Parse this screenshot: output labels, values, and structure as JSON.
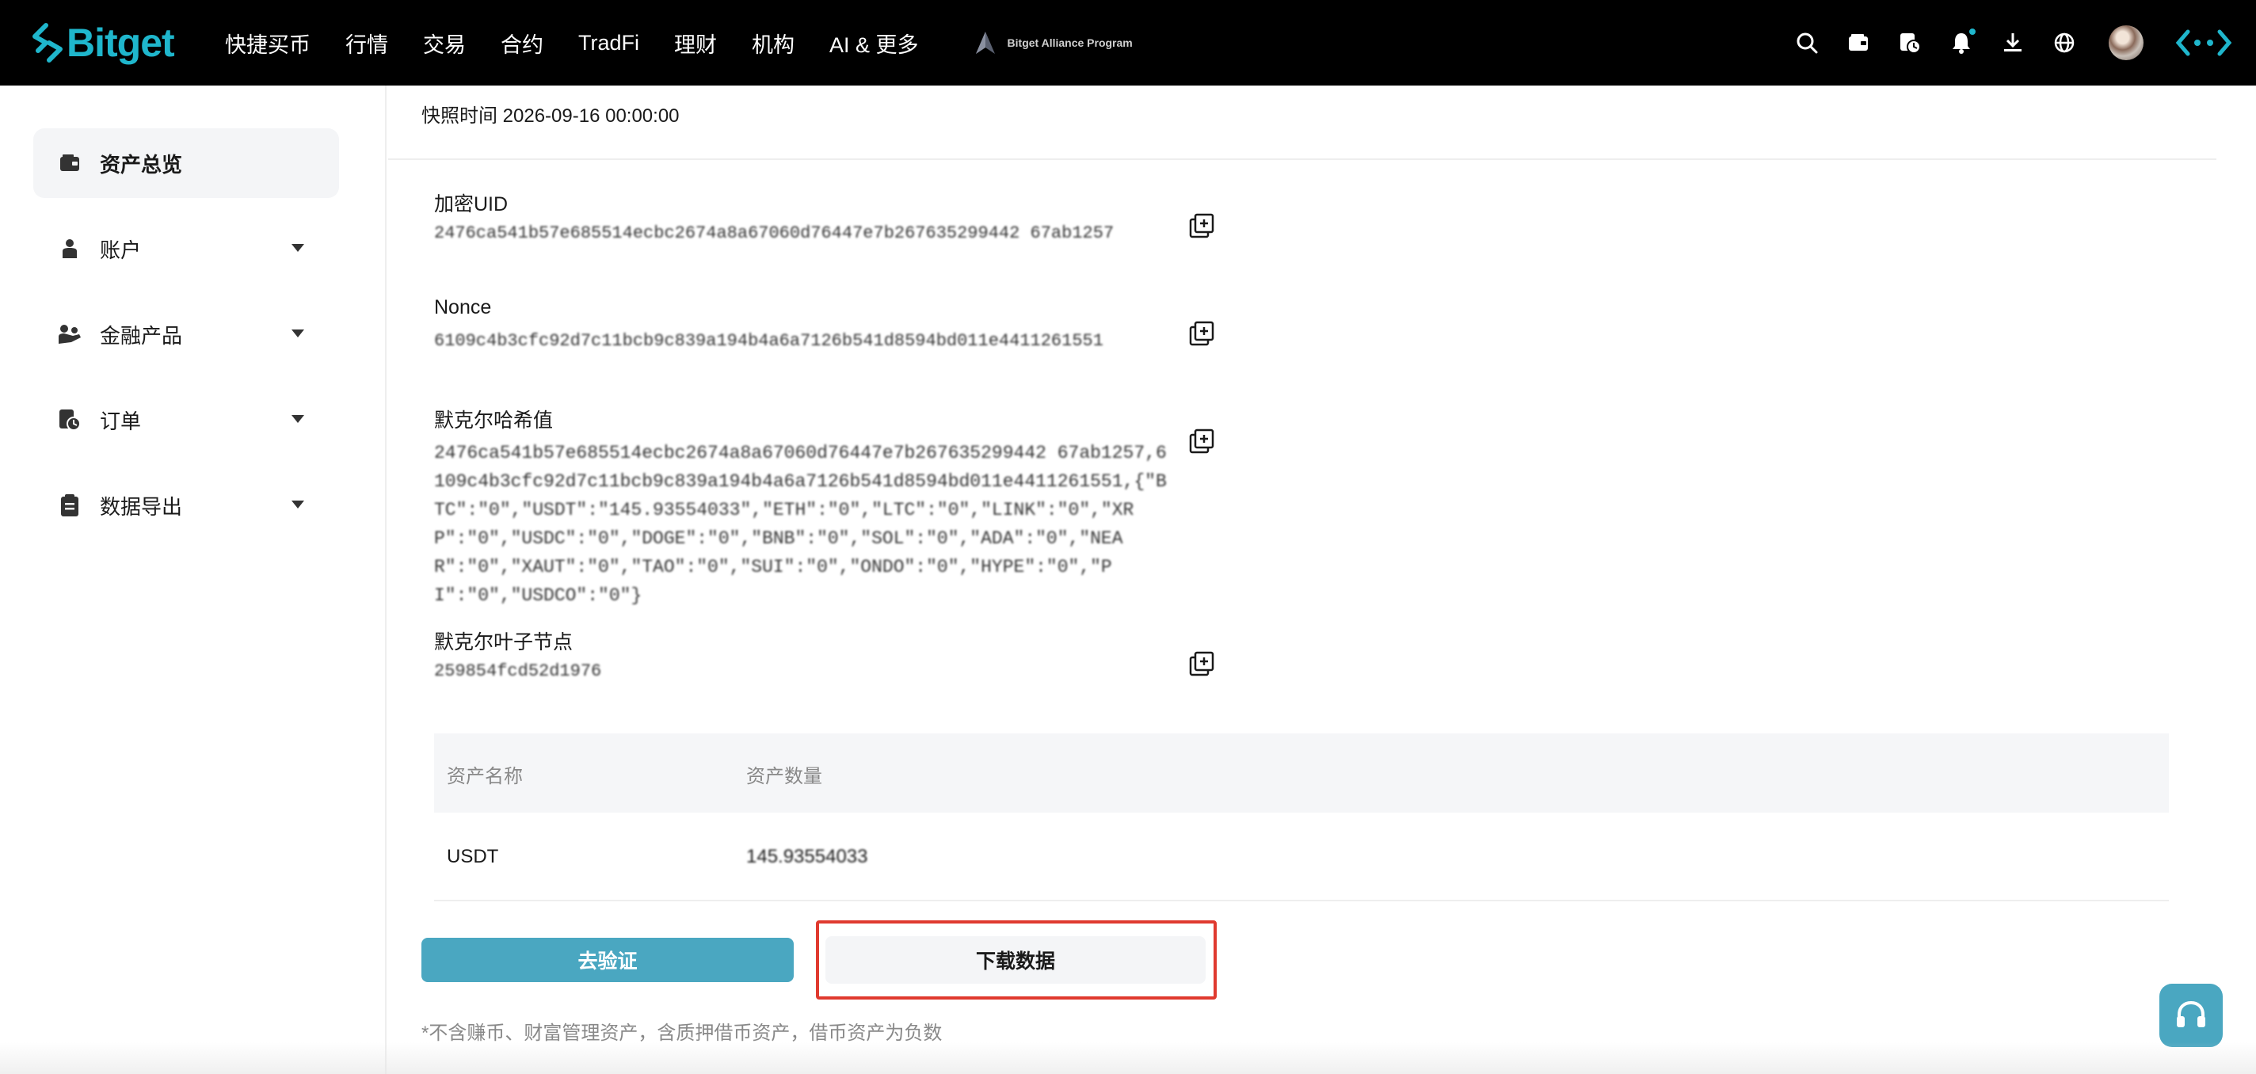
{
  "header": {
    "logo_text": "Bitget",
    "nav": [
      "快捷买币",
      "行情",
      "交易",
      "合约",
      "TradFi",
      "理财",
      "机构",
      "AI & 更多"
    ],
    "alliance_label": "Bitget Alliance Program",
    "icons": [
      "search-icon",
      "wallet-icon",
      "history-icon",
      "bell-icon",
      "download-icon",
      "globe-icon",
      "avatar",
      "brand-mark-icon"
    ],
    "accent_color": "#1fb6cc"
  },
  "sidebar": {
    "items": [
      {
        "label": "资产总览",
        "icon": "wallet-icon",
        "active": true
      },
      {
        "label": "账户",
        "icon": "user-icon",
        "active": false
      },
      {
        "label": "金融产品",
        "icon": "finance-icon",
        "active": false
      },
      {
        "label": "订单",
        "icon": "order-icon",
        "active": false
      },
      {
        "label": "数据导出",
        "icon": "clipboard-icon",
        "active": false
      }
    ]
  },
  "main": {
    "snapshot": "快照时间 2026-09-16 00:00:00",
    "fields": [
      {
        "label": "加密UID",
        "value": "2476ca541b57e685514ecbc2674a8a67060d76447e7b267635299442 67ab1257"
      },
      {
        "label": "Nonce",
        "value": "6109c4b3cfc92d7c11bcb9c839a194b4a6a7126b541d8594bd011e4411261551"
      },
      {
        "label": "默克尔哈希值",
        "value": "2476ca541b57e685514ecbc2674a8a67060d76447e7b267635299442 67ab1257,6109c4b3cfc92d7c11bcb9c839a194b4a6a7126b541d8594bd011e4411261551,{\"BTC\":\"0\",\"USDT\":\"145.93554033\",\"ETH\":\"0\",\"LTC\":\"0\",\"LINK\":\"0\",\"XRP\":\"0\",\"USDC\":\"0\",\"DOGE\":\"0\",\"BNB\":\"0\",\"SOL\":\"0\",\"ADA\":\"0\",\"NEAR\":\"0\",\"XAUT\":\"0\",\"TAO\":\"0\",\"SUI\":\"0\",\"ONDO\":\"0\",\"HYPE\":\"0\",\"PI\":\"0\",\"USDCO\":\"0\"}"
      },
      {
        "label": "默克尔叶子节点",
        "value": "259854fcd52d1976"
      }
    ],
    "table": {
      "columns": [
        "资产名称",
        "资产数量"
      ],
      "rows": [
        {
          "name": "USDT",
          "amount": "145.93554033"
        }
      ]
    },
    "verify_button": "去验证",
    "download_button": "下载数据",
    "note": "*不含赚币、财富管理资产，含质押借币资产，借币资产为负数"
  },
  "colors": {
    "verify_button": "#4aa7c1",
    "highlight_border": "#e03a2f",
    "muted_text": "#888888"
  }
}
